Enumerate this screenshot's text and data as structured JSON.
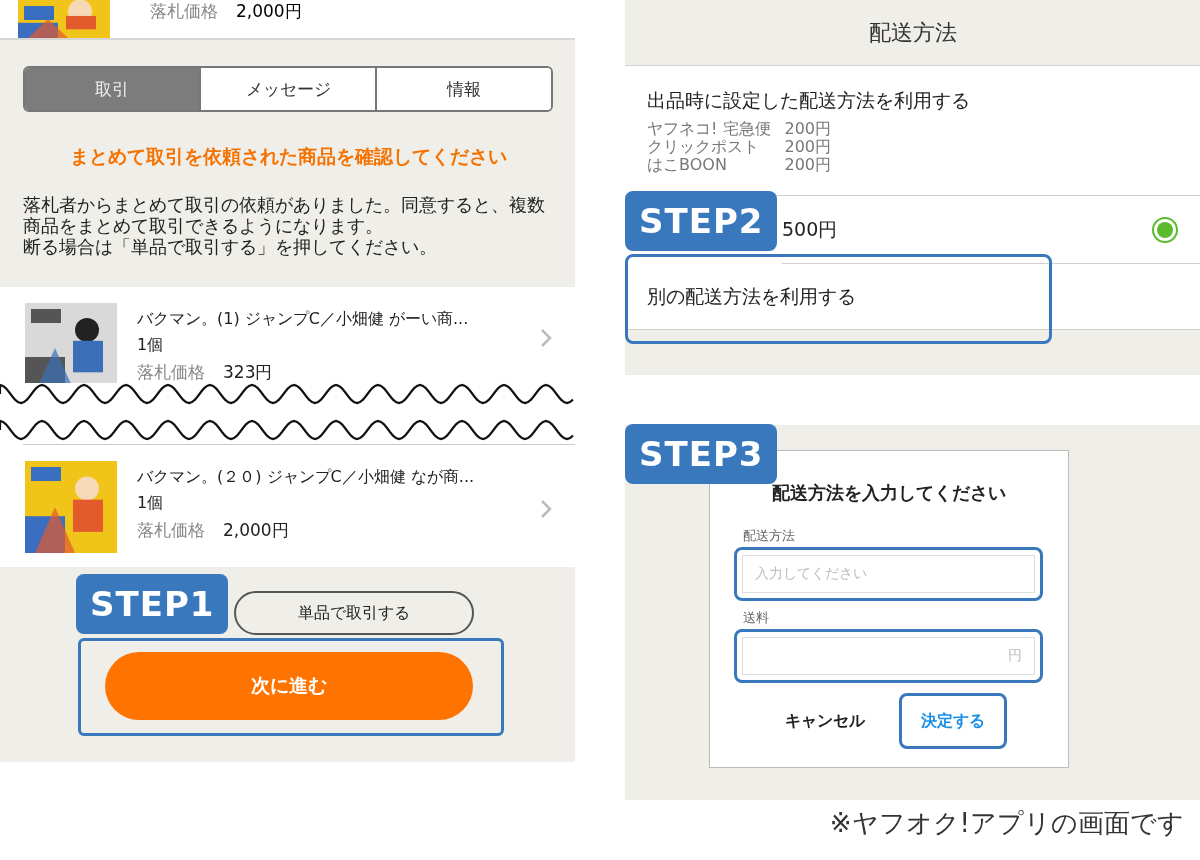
{
  "left_screen": {
    "previous_item": {
      "price_label": "落札価格",
      "price": "2,000円"
    },
    "tabs": [
      {
        "label": "取引",
        "selected": true
      },
      {
        "label": "メッセージ",
        "selected": false
      },
      {
        "label": "情報",
        "selected": false
      }
    ],
    "notice_heading": "まとめて取引を依頼された商品を確認してください",
    "notice_body": [
      "落札者からまとめて取引の依頼がありました。同意すると、複数商品をまとめて取引できるようになります。",
      "断る場合は「単品で取引する」を押してください。"
    ],
    "items": [
      {
        "title": "バクマン。(1) ジャンプC／小畑健 がーい商...",
        "quantity": "1個",
        "price_label": "落札価格",
        "price": "323円"
      },
      {
        "title": "バクマン。(２０) ジャンプC／小畑健 なが商...",
        "quantity": "1個",
        "price_label": "落札価格",
        "price": "2,000円"
      }
    ],
    "single_button": "単品で取引する",
    "next_button": {
      "label": "次に進む",
      "highlighted": true
    },
    "step_badge": "STEP1"
  },
  "right_screen_top": {
    "title": "配送方法",
    "options": [
      {
        "kind": "preset",
        "label": "出品時に設定した配送方法を利用する",
        "methods": [
          {
            "name": "ヤフネコ! 宅急便",
            "price": "200円"
          },
          {
            "name": "クリックポスト",
            "price": "200円"
          },
          {
            "name": "はこBOON",
            "price": "200円"
          }
        ],
        "selected": false,
        "highlighted": false
      },
      {
        "kind": "price",
        "label": "500円",
        "selected": true,
        "highlighted": false
      },
      {
        "kind": "custom",
        "label": "別の配送方法を利用する",
        "selected": false,
        "highlighted": true
      }
    ],
    "step_badge": "STEP2"
  },
  "right_screen_bottom": {
    "dialog": {
      "title": "配送方法を入力してください",
      "fields": [
        {
          "label": "配送方法",
          "placeholder": "入力してください",
          "highlighted": true
        },
        {
          "label": "送料",
          "unit": "円",
          "highlighted": true
        }
      ],
      "buttons": [
        {
          "label": "キャンセル",
          "highlighted": false
        },
        {
          "label": "決定する",
          "highlighted": true
        }
      ]
    },
    "step_badge": "STEP3"
  },
  "caption": "※ヤフオク!アプリの画面です"
}
